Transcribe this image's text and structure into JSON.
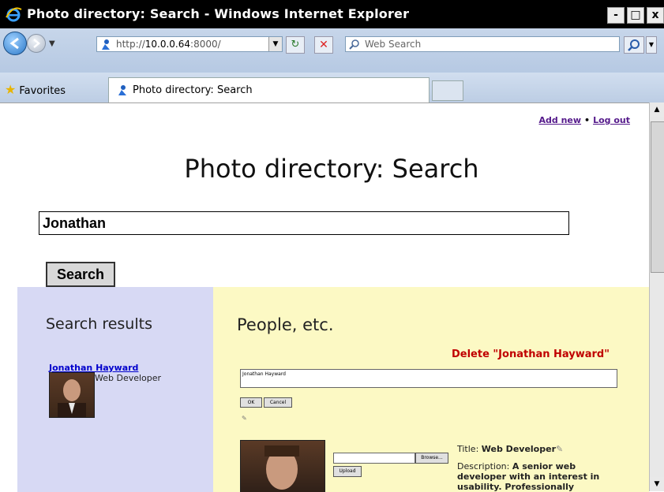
{
  "window": {
    "title": "Photo directory: Search - Windows Internet Explorer",
    "buttons": {
      "minimize": "-",
      "maximize": "□",
      "close": "x"
    }
  },
  "nav": {
    "url_prefix": "http://",
    "url_host": "10.0.0.64",
    "url_port": ":8000/",
    "search_placeholder": "Web Search"
  },
  "tabs": {
    "favorites_label": "Favorites",
    "active_tab_label": "Photo directory: Search"
  },
  "page": {
    "top_links": {
      "add_new": "Add new",
      "separator": "•",
      "log_out": "Log out"
    },
    "heading": "Photo directory: Search",
    "query_value": "Jonathan",
    "search_button": "Search",
    "results": {
      "title": "Search results",
      "items": [
        {
          "name": "Jonathan Hayward",
          "title": "Web Developer"
        }
      ]
    },
    "people": {
      "title": "People, etc.",
      "delete_link": "Delete \"Jonathan Hayward\"",
      "name_field_value": "Jonathan Hayward",
      "ok_label": "OK",
      "cancel_label": "Cancel",
      "browse_label": "Browse...",
      "upload_label": "Upload",
      "title_label": "Title:",
      "title_value": "Web Developer",
      "description_label": "Description:",
      "description_value": "A senior web developer with an interest in usability. Professionally interested in"
    }
  },
  "colors": {
    "left_panel": "#d7d9f4",
    "right_panel": "#fcf9c4",
    "delete_red": "#c00000"
  }
}
